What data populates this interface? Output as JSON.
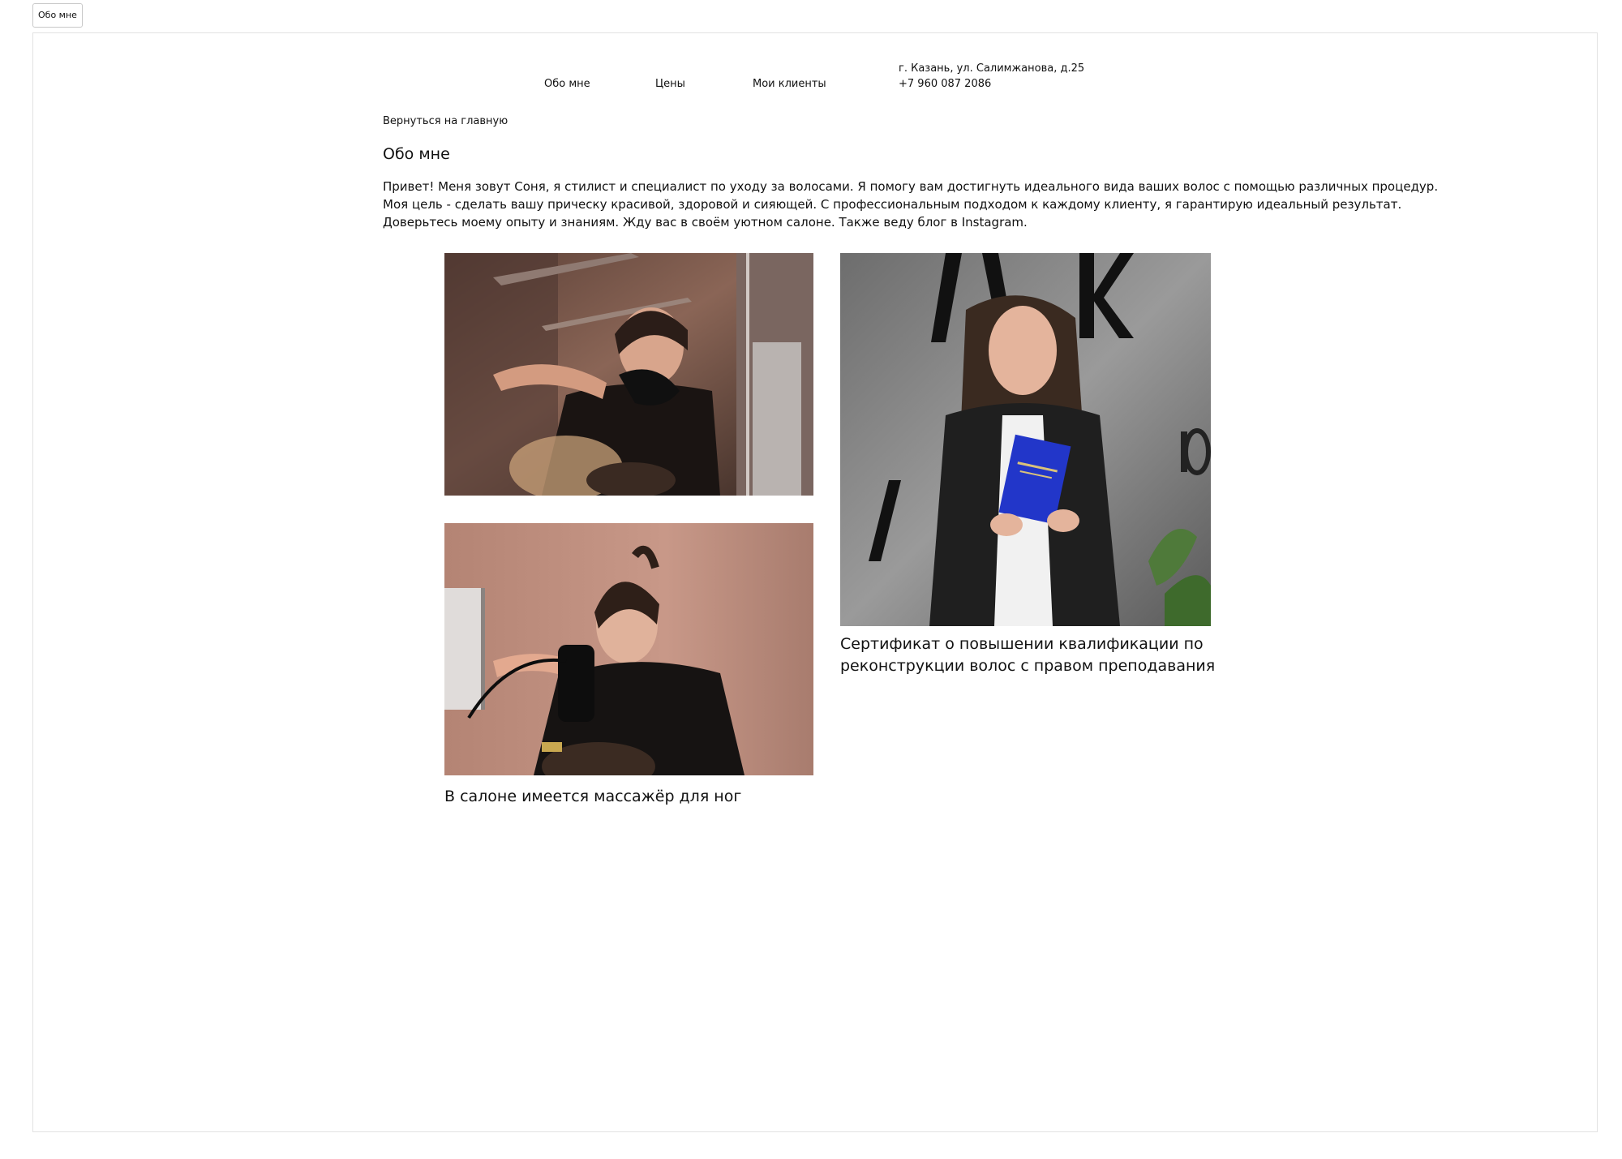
{
  "tab": {
    "label": "Обо мне"
  },
  "nav": {
    "items": [
      {
        "label": "Обо мне"
      },
      {
        "label": "Цены"
      },
      {
        "label": "Мои клиенты"
      }
    ],
    "address": "г. Казань, ул. Салимжанова, д.25",
    "phone": "+7 960 087 2086"
  },
  "back_link": "Вернуться на главную",
  "page_title": "Обо мне",
  "about_text": "Привет! Меня зовут Соня, я стилист и специалист по уходу за волосами. Я помогу вам достигнуть идеального вида ваших волос с помощью различных процедур. Моя цель - сделать вашу прическу красивой, здоровой и сияющей. С профессиональным подходом к каждому клиенту, я гарантирую идеальный результат. Доверьтесь моему опыту и знаниям. Жду вас в своём уютном салоне. Также веду блог в Instagram.",
  "gallery": {
    "captions": [
      "В салоне имеется массажёр для ног",
      "Сертификат о повышении квалификации по реконструкции волос с правом преподавания"
    ]
  },
  "colors": {
    "text": "#111111",
    "frame_border": "#e2e2e2",
    "salon_wall": "#8a6556",
    "certificate_blue": "#2236c9"
  }
}
